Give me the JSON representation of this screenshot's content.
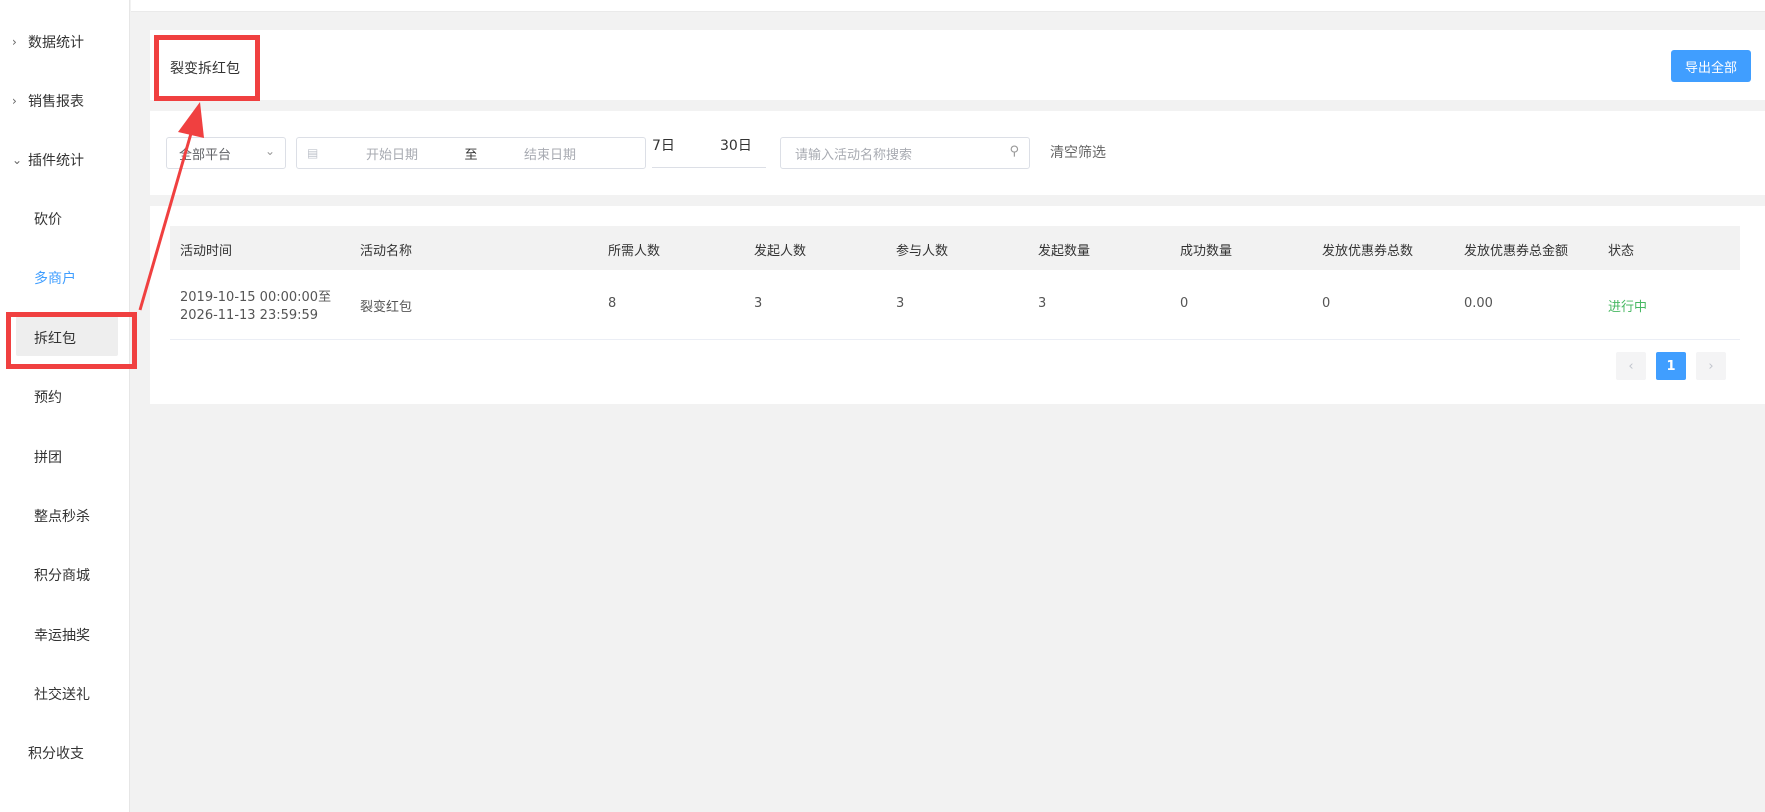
{
  "sidebar": {
    "groups": [
      {
        "label": "数据统计"
      },
      {
        "label": "销售报表"
      },
      {
        "label": "插件统计"
      }
    ],
    "items": [
      {
        "label": "砍价"
      },
      {
        "label": "多商户"
      },
      {
        "label": "拆红包"
      },
      {
        "label": "预约"
      },
      {
        "label": "拼团"
      },
      {
        "label": "整点秒杀"
      },
      {
        "label": "积分商城"
      },
      {
        "label": "幸运抽奖"
      },
      {
        "label": "社交送礼"
      },
      {
        "label": "积分收支"
      }
    ],
    "link_color": "#409eff"
  },
  "header": {
    "title": "裂变拆红包",
    "export_label": "导出全部"
  },
  "filter": {
    "platform_value": "全部平台",
    "start_placeholder": "开始日期",
    "separator": "至",
    "end_placeholder": "结束日期",
    "quick_7": "7日",
    "quick_30": "30日",
    "search_placeholder": "请输入活动名称搜索",
    "clear_label": "清空筛选"
  },
  "table": {
    "columns": [
      "活动时间",
      "活动名称",
      "所需人数",
      "发起人数",
      "参与人数",
      "发起数量",
      "成功数量",
      "发放优惠券总数",
      "发放优惠券总金额",
      "状态"
    ],
    "rows": [
      {
        "time_start": "2019-10-15 00:00:00至",
        "time_end": "2026-11-13 23:59:59",
        "name": "裂变红包",
        "required": "8",
        "initiators": "3",
        "participants": "3",
        "launched": "3",
        "succeeded": "0",
        "coupons": "0",
        "coupon_amount": "0.00",
        "status": "进行中"
      }
    ]
  },
  "pagination": {
    "prev": "‹",
    "current": "1",
    "next": "›"
  },
  "colors": {
    "accent": "#409eff",
    "status_active": "#47b862",
    "annotation": "#f04040"
  }
}
